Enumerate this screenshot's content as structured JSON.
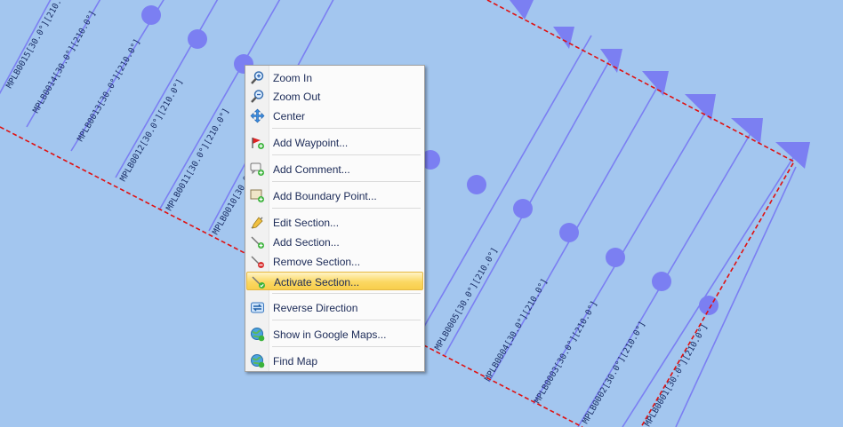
{
  "map": {
    "line_color": "#7b7ff2",
    "boundary_color": "#e01010",
    "background": "#a3c6ef",
    "section_labels": [
      "MPLB0015[30.0°][210.0°]",
      "MPLB0014[30.0°][210.0°]",
      "MPLB0013[30.0°][210.0°]",
      "MPLB0012[30.0°][210.0°]",
      "MPLB0011[30.0°][210.0°]",
      "MPLB0010[30.0°][210.0°]",
      "MPLB0005[30.0°][210.0°]",
      "MPLB0004[30.0°][210.0°]",
      "MPLB0003[30.0°][210.0°]",
      "MPLB0002[30.0°][210.0°]",
      "MPLB0001[30.0°][210.0°]"
    ]
  },
  "context_menu": {
    "items": [
      {
        "label": "Zoom In",
        "icon": "zoom-in-icon"
      },
      {
        "label": "Zoom Out",
        "icon": "zoom-out-icon"
      },
      {
        "label": "Center",
        "icon": "center-icon"
      },
      {
        "label": "Add Waypoint...",
        "icon": "add-waypoint-icon"
      },
      {
        "label": "Add Comment...",
        "icon": "add-comment-icon"
      },
      {
        "label": "Add Boundary Point...",
        "icon": "add-boundary-point-icon"
      },
      {
        "label": "Edit Section...",
        "icon": "edit-section-icon"
      },
      {
        "label": "Add Section...",
        "icon": "add-section-icon"
      },
      {
        "label": "Remove Section...",
        "icon": "remove-section-icon"
      },
      {
        "label": "Activate Section...",
        "icon": "activate-section-icon",
        "highlighted": true
      },
      {
        "label": "Reverse Direction",
        "icon": "reverse-direction-icon"
      },
      {
        "label": "Show in Google Maps...",
        "icon": "google-maps-icon"
      },
      {
        "label": "Find Map",
        "icon": "find-map-icon"
      }
    ]
  }
}
